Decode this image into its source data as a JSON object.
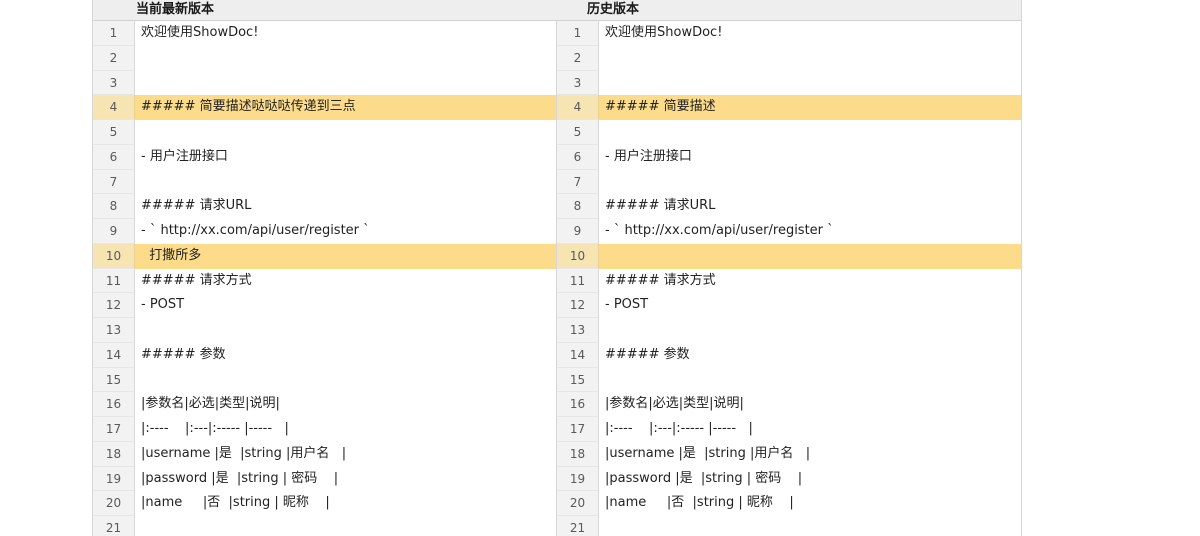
{
  "headers": {
    "current": "当前最新版本",
    "history": "历史版本"
  },
  "left_lines": [
    {
      "num": "1",
      "text": "欢迎使用ShowDoc!",
      "hl": false
    },
    {
      "num": "2",
      "text": "",
      "hl": false
    },
    {
      "num": "3",
      "text": "",
      "hl": false
    },
    {
      "num": "4",
      "text": "##### 简要描述哒哒哒传递到三点",
      "hl": true
    },
    {
      "num": "5",
      "text": "",
      "hl": false
    },
    {
      "num": "6",
      "text": "- 用户注册接口",
      "hl": false
    },
    {
      "num": "7",
      "text": "",
      "hl": false
    },
    {
      "num": "8",
      "text": "##### 请求URL",
      "hl": false
    },
    {
      "num": "9",
      "text": "- ` http://xx.com/api/user/register `",
      "hl": false
    },
    {
      "num": "10",
      "text": "  打撒所多",
      "hl": true
    },
    {
      "num": "11",
      "text": "##### 请求方式",
      "hl": false
    },
    {
      "num": "12",
      "text": "- POST",
      "hl": false
    },
    {
      "num": "13",
      "text": "",
      "hl": false
    },
    {
      "num": "14",
      "text": "##### 参数",
      "hl": false
    },
    {
      "num": "15",
      "text": "",
      "hl": false
    },
    {
      "num": "16",
      "text": "|参数名|必选|类型|说明|",
      "hl": false
    },
    {
      "num": "17",
      "text": "|:----    |:---|:----- |-----   |",
      "hl": false
    },
    {
      "num": "18",
      "text": "|username |是  |string |用户名   |",
      "hl": false
    },
    {
      "num": "19",
      "text": "|password |是  |string | 密码    |",
      "hl": false
    },
    {
      "num": "20",
      "text": "|name     |否  |string | 昵称    |",
      "hl": false
    },
    {
      "num": "21",
      "text": "",
      "hl": false
    }
  ],
  "right_lines": [
    {
      "num": "1",
      "text": "欢迎使用ShowDoc!",
      "hl": false
    },
    {
      "num": "2",
      "text": "",
      "hl": false
    },
    {
      "num": "3",
      "text": "",
      "hl": false
    },
    {
      "num": "4",
      "text": "##### 简要描述",
      "hl": true
    },
    {
      "num": "5",
      "text": "",
      "hl": false
    },
    {
      "num": "6",
      "text": "- 用户注册接口",
      "hl": false
    },
    {
      "num": "7",
      "text": "",
      "hl": false
    },
    {
      "num": "8",
      "text": "##### 请求URL",
      "hl": false
    },
    {
      "num": "9",
      "text": "- ` http://xx.com/api/user/register `",
      "hl": false
    },
    {
      "num": "10",
      "text": "",
      "hl": true
    },
    {
      "num": "11",
      "text": "##### 请求方式",
      "hl": false
    },
    {
      "num": "12",
      "text": "- POST",
      "hl": false
    },
    {
      "num": "13",
      "text": "",
      "hl": false
    },
    {
      "num": "14",
      "text": "##### 参数",
      "hl": false
    },
    {
      "num": "15",
      "text": "",
      "hl": false
    },
    {
      "num": "16",
      "text": "|参数名|必选|类型|说明|",
      "hl": false
    },
    {
      "num": "17",
      "text": "|:----    |:---|:----- |-----   |",
      "hl": false
    },
    {
      "num": "18",
      "text": "|username |是  |string |用户名   |",
      "hl": false
    },
    {
      "num": "19",
      "text": "|password |是  |string | 密码    |",
      "hl": false
    },
    {
      "num": "20",
      "text": "|name     |否  |string | 昵称    |",
      "hl": false
    },
    {
      "num": "21",
      "text": "",
      "hl": false
    }
  ],
  "colors": {
    "highlight_line": "#fcdc8a",
    "highlight_gutter": "#f6e4b3",
    "gutter": "#f2f2f2",
    "header_bg": "#eeeeee"
  }
}
